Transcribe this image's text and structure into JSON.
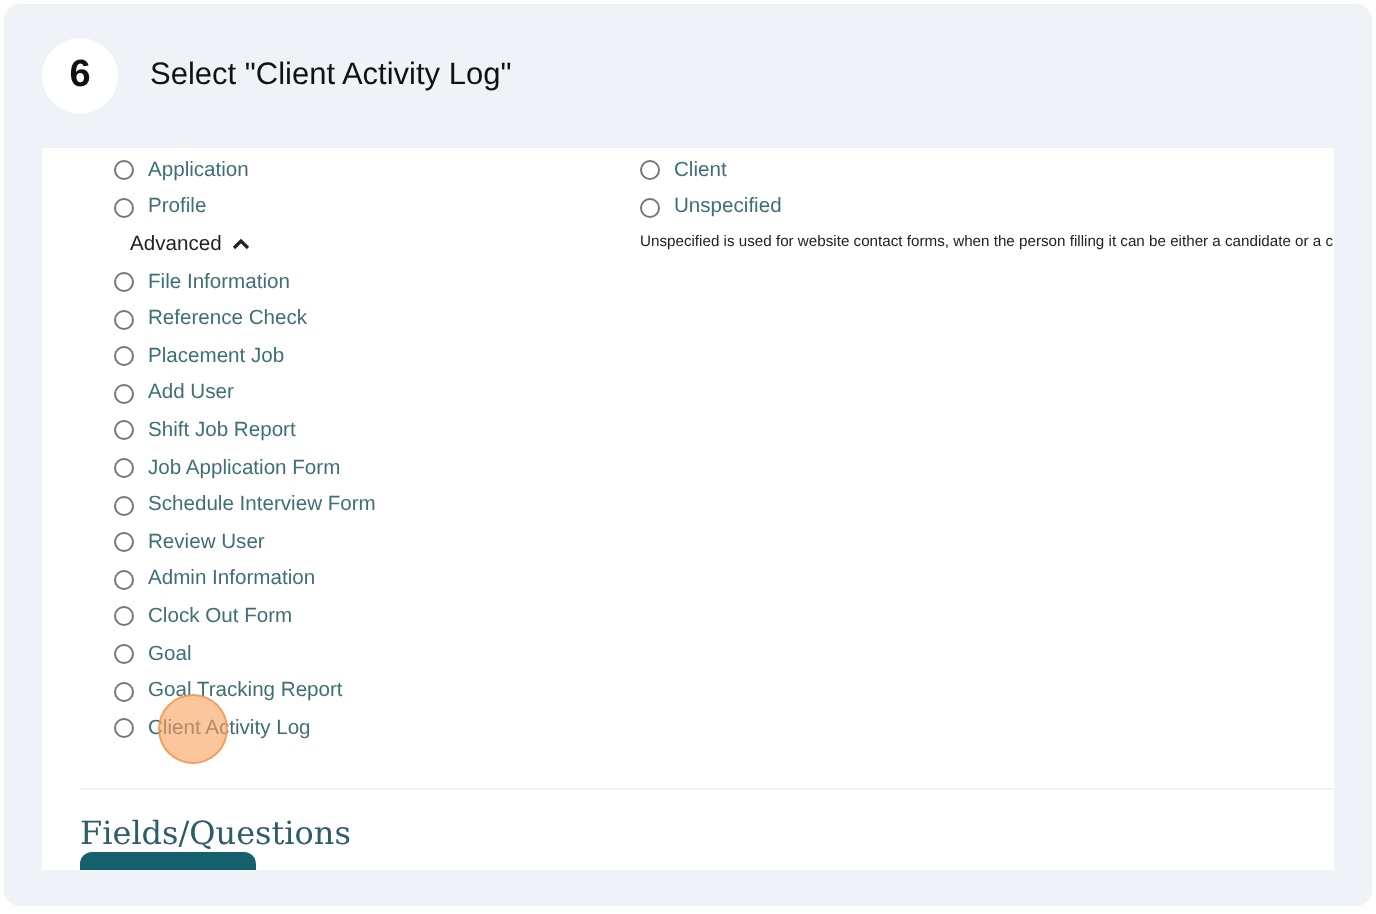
{
  "step": {
    "number": "6",
    "title": "Select \"Client Activity Log\""
  },
  "left_column": {
    "basic_items": [
      {
        "label": "Application",
        "selected": false
      },
      {
        "label": "Profile",
        "selected": false
      }
    ],
    "advanced_toggle": {
      "label": "Advanced",
      "expanded": true
    },
    "advanced_items": [
      {
        "label": "File Information",
        "selected": false
      },
      {
        "label": "Reference Check",
        "selected": false
      },
      {
        "label": "Placement Job",
        "selected": false
      },
      {
        "label": "Add User",
        "selected": false
      },
      {
        "label": "Shift Job Report",
        "selected": false
      },
      {
        "label": "Job Application Form",
        "selected": false
      },
      {
        "label": "Schedule Interview Form",
        "selected": false
      },
      {
        "label": "Review User",
        "selected": false
      },
      {
        "label": "Admin Information",
        "selected": false
      },
      {
        "label": "Clock Out Form",
        "selected": false
      },
      {
        "label": "Goal",
        "selected": false
      },
      {
        "label": "Goal Tracking Report",
        "selected": false
      },
      {
        "label": "Client Activity Log",
        "selected": false
      }
    ]
  },
  "right_column": {
    "items": [
      {
        "label": "Client",
        "selected": false
      },
      {
        "label": "Unspecified",
        "selected": false
      }
    ],
    "note": "Unspecified is used for website contact forms, when the person filling it can be either a candidate or a c"
  },
  "section_heading": "Fields/Questions"
}
